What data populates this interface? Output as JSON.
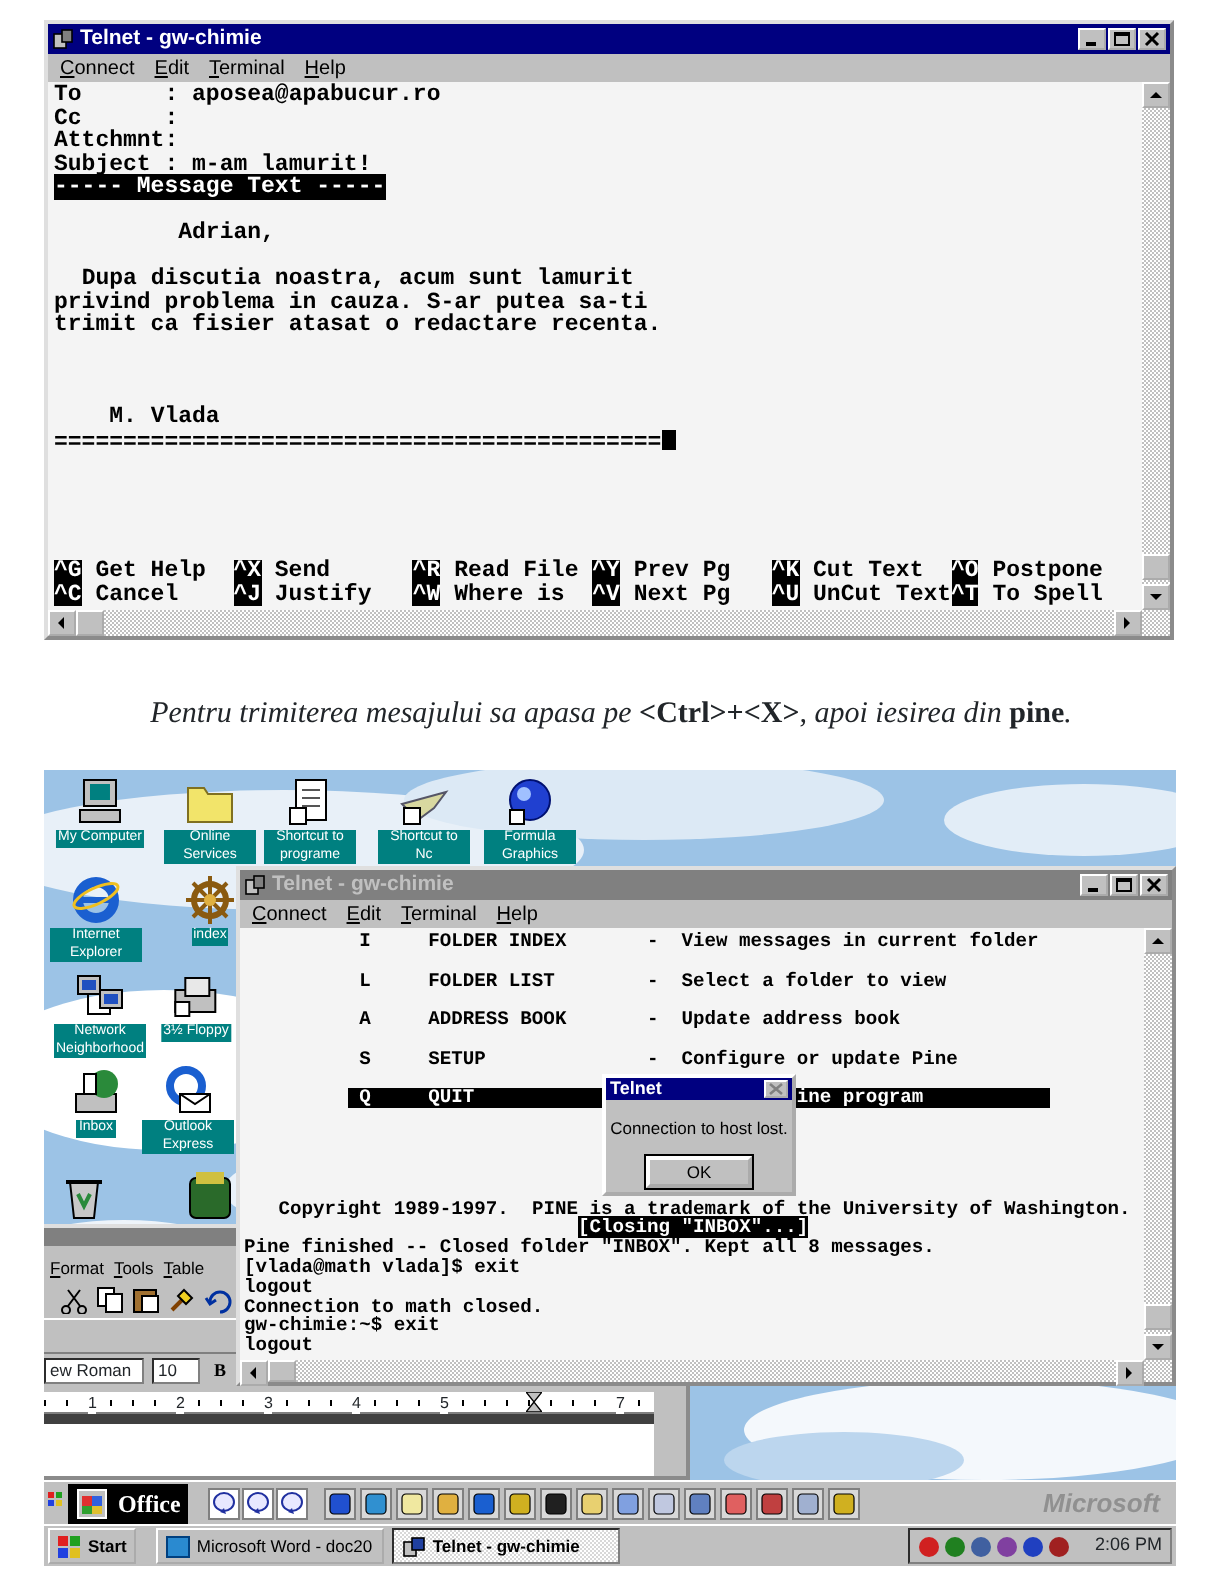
{
  "telnet_compose": {
    "title": "Telnet - gw-chimie",
    "active": true,
    "menu": [
      "Connect",
      "Edit",
      "Terminal",
      "Help"
    ],
    "headers": [
      "To      : aposea@apabucur.ro",
      "Cc      :",
      "Attchmnt:",
      "Subject : m-am lamurit!"
    ],
    "separator": "----- Message Text -----",
    "greeting": "         Adrian,",
    "body": [
      "  Dupa discutia noastra, acum sunt lamurit",
      "privind problema in cauza. S-ar putea sa-ti",
      "trimit ca fisier atasat o redactare recenta."
    ],
    "signature": "    M. Vlada",
    "rule": "============================================",
    "cursor": true,
    "shortcuts": [
      {
        "key": "^G",
        "label": "Get Help"
      },
      {
        "key": "^X",
        "label": "Send"
      },
      {
        "key": "^R",
        "label": "Read File"
      },
      {
        "key": "^Y",
        "label": "Prev Pg"
      },
      {
        "key": "^K",
        "label": "Cut Text"
      },
      {
        "key": "^O",
        "label": "Postpone"
      },
      {
        "key": "^C",
        "label": "Cancel"
      },
      {
        "key": "^J",
        "label": "Justify"
      },
      {
        "key": "^W",
        "label": "Where is"
      },
      {
        "key": "^V",
        "label": "Next Pg"
      },
      {
        "key": "^U",
        "label": "UnCut Text"
      },
      {
        "key": "^T",
        "label": "To Spell"
      }
    ]
  },
  "caption": "Pentru trimiterea mesajului sa apasa pe **<Ctrl>+<X>**, apoi iesirea din **pine**.",
  "desktop": {
    "icons": [
      {
        "label": "My Computer"
      },
      {
        "label": "Online Services"
      },
      {
        "label": "Shortcut to programe"
      },
      {
        "label": "Shortcut to Nc"
      },
      {
        "label": "Formula Graphics"
      },
      {
        "label": "Internet Explorer"
      },
      {
        "label": "index"
      },
      {
        "label": "Network Neighborhood"
      },
      {
        "label": "3½ Floppy"
      },
      {
        "label": "Inbox"
      },
      {
        "label": "Outlook Express"
      }
    ]
  },
  "word_window": {
    "active": false,
    "menu": [
      "Format",
      "Tools",
      "Table"
    ],
    "font": "ew Roman",
    "size": "10",
    "bold": "B",
    "ruler": [
      "1",
      "2",
      "3",
      "4",
      "5",
      "7"
    ]
  },
  "telnet_session": {
    "title": "Telnet - gw-chimie",
    "active": false,
    "menu": [
      "Connect",
      "Edit",
      "Terminal",
      "Help"
    ],
    "pine_menu": [
      {
        "key": "I",
        "name": "FOLDER INDEX",
        "separator": "-",
        "description": "View messages in current folder",
        "selected": false
      },
      {
        "key": "L",
        "name": "FOLDER LIST",
        "separator": "-",
        "description": "Select a folder to view",
        "selected": false
      },
      {
        "key": "A",
        "name": "ADDRESS BOOK",
        "separator": "-",
        "description": "Update address book",
        "selected": false
      },
      {
        "key": "S",
        "name": "SETUP",
        "separator": "-",
        "description": "Configure or update Pine",
        "selected": false
      },
      {
        "key": "Q",
        "name": "QUIT",
        "description": "ine program",
        "selected": true
      }
    ],
    "lines": [
      {
        "text": "   Copyright 1989-1997.  PINE is a trademark of the University of Washington.",
        "inverse": false
      },
      {
        "text": "                             [Closing \"INBOX\"...]",
        "inverse": true
      },
      {
        "text": "Pine finished -- Closed folder \"INBOX\". Kept all 8 messages.",
        "inverse": false
      },
      {
        "text": "[vlada@math vlada]$ exit",
        "inverse": false
      },
      {
        "text": "logout",
        "inverse": false
      },
      {
        "text": "Connection to math closed.",
        "inverse": false
      },
      {
        "text": "gw-chimie:~$ exit",
        "inverse": false
      },
      {
        "text": "logout",
        "inverse": false
      }
    ]
  },
  "dialog": {
    "title": "Telnet",
    "message": "Connection to host lost.",
    "button": "OK"
  },
  "office_bar": {
    "label": "Office",
    "brand": "Microsoft"
  },
  "taskbar": {
    "start": "Start",
    "buttons": [
      {
        "label": "Microsoft Word - doc20",
        "selected": false
      },
      {
        "label": "Telnet - gw-chimie",
        "selected": true
      }
    ],
    "clock": "2:06 PM"
  }
}
